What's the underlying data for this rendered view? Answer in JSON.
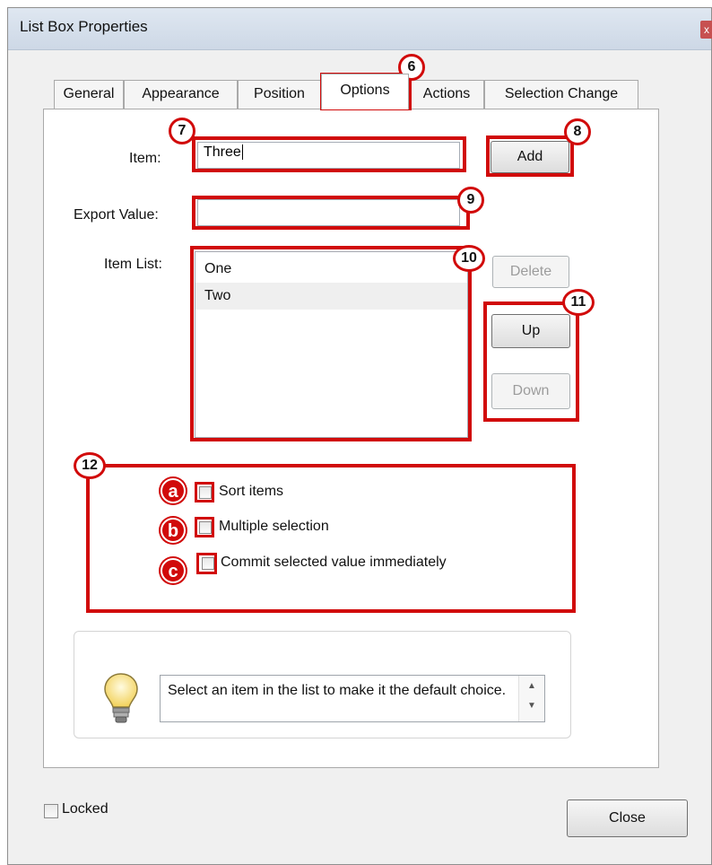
{
  "window": {
    "title": "List Box Properties",
    "close_glyph": "x"
  },
  "tabs": [
    {
      "label": "General",
      "active": false
    },
    {
      "label": "Appearance",
      "active": false
    },
    {
      "label": "Position",
      "active": false
    },
    {
      "label": "Options",
      "active": true
    },
    {
      "label": "Actions",
      "active": false
    },
    {
      "label": "Selection Change",
      "active": false
    }
  ],
  "form": {
    "item_label": "Item:",
    "item_value": "Three",
    "add_button": "Add",
    "export_label": "Export Value:",
    "export_value": "",
    "item_list_label": "Item List:",
    "item_list": [
      {
        "label": "One",
        "selected": false
      },
      {
        "label": "Two",
        "selected": true
      }
    ],
    "delete_button": "Delete",
    "up_button": "Up",
    "down_button": "Down"
  },
  "options": [
    {
      "label": "Sort items",
      "checked": false
    },
    {
      "label": "Multiple selection",
      "checked": false
    },
    {
      "label": "Commit selected value immediately",
      "checked": false
    }
  ],
  "hint": {
    "icon": "lightbulb-icon",
    "text": "Select an item in the list to make it the default choice."
  },
  "footer": {
    "locked_label": "Locked",
    "locked_checked": false,
    "close_button": "Close"
  },
  "annotations": {
    "numbers": [
      "6",
      "7",
      "8",
      "9",
      "10",
      "11",
      "12"
    ],
    "letters": [
      "a",
      "b",
      "c"
    ],
    "color": "#d10a0a"
  },
  "colors": {
    "annotation_red": "#d10a0a",
    "dialog_background": "#f0f0f0",
    "titlebar": "#dfe7f1",
    "selected_row": "#efefef"
  }
}
